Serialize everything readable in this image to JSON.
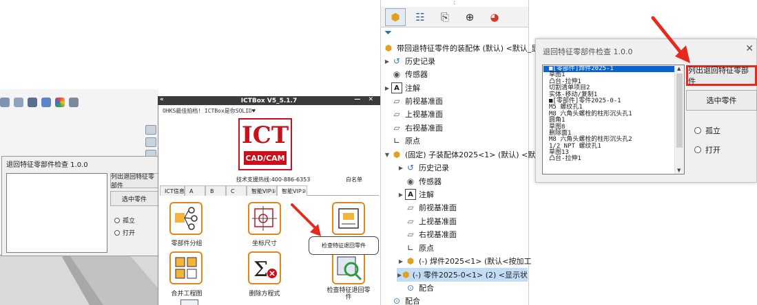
{
  "ictbox": {
    "title": "ICTBox V5_5.1.7",
    "collapse": "«",
    "controls": "— ✕",
    "marquee": "OHKS最佳拍档! ICTBox是你SOLID♥",
    "logo_main": "ICT",
    "logo_sub": "CAD/CAM",
    "hotline": "技术支援热线:400-886-6353",
    "whitelist": "白名单",
    "tabs": [
      "ICT信息",
      "A",
      "B",
      "C",
      "智能VIP①",
      "智能VIP②"
    ],
    "active_tab": 5,
    "tiles": [
      {
        "label": "零部件分组"
      },
      {
        "label": "坐标尺寸"
      },
      {
        "label": ""
      },
      {
        "label": "合并工程图"
      },
      {
        "label": "删除方程式"
      },
      {
        "label": "检查特征退回零件"
      }
    ],
    "tooltip": "检查特征退回零件"
  },
  "small_dialog": {
    "title": "退回特征零部件检查 1.0.0",
    "btn_list": "列出退回特征零部件",
    "btn_select": "选中零件",
    "radio_isolate": "孤立",
    "radio_open": "打开"
  },
  "tree": {
    "root": "带回退特征零件的装配体 (默认) <默认_显",
    "items": [
      {
        "label": "历史记录",
        "icon": "history-icon"
      },
      {
        "label": "传感器",
        "icon": "sensor-icon"
      },
      {
        "label": "注解",
        "icon": "annotation-icon"
      },
      {
        "label": "前视基准面",
        "icon": "plane-icon"
      },
      {
        "label": "上视基准面",
        "icon": "plane-icon"
      },
      {
        "label": "右视基准面",
        "icon": "plane-icon"
      },
      {
        "label": "原点",
        "icon": "origin-icon"
      },
      {
        "label": "(固定) 子装配体2025<1> (默认) <默",
        "icon": "subassembly-icon"
      },
      {
        "label": "历史记录",
        "icon": "history-icon"
      },
      {
        "label": "传感器",
        "icon": "sensor-icon"
      },
      {
        "label": "注解",
        "icon": "annotation-icon"
      },
      {
        "label": "前视基准面",
        "icon": "plane-icon"
      },
      {
        "label": "上视基准面",
        "icon": "plane-icon"
      },
      {
        "label": "右视基准面",
        "icon": "plane-icon"
      },
      {
        "label": "原点",
        "icon": "origin-icon"
      },
      {
        "label": "(-) 焊件2025<1> (默认<按加工",
        "icon": "part-icon"
      },
      {
        "label": "(-) 零件2025-0<1> (2) <显示状",
        "icon": "part-icon"
      },
      {
        "label": "配合",
        "icon": "mate-icon"
      },
      {
        "label": "配合",
        "icon": "mate-icon"
      }
    ]
  },
  "big_dialog": {
    "title": "退回特征零部件检查 1.0.0",
    "close": "✕",
    "list_items": [
      "■[零部件]焊件2025-1",
      "草图1",
      "凸台-拉伸1",
      "切割清单项目2",
      "实体-移动/复制1",
      "■[零部件]零件2025-0-1",
      "M5 螺纹孔1",
      "M8 六角头螺栓的柱形沉头孔1",
      "圆角1",
      "草图8",
      "删除面1",
      "M8 六角头螺栓的柱形沉头孔2",
      "1/2 NPT 螺纹孔1",
      "草图13",
      "凸台-拉伸1"
    ],
    "btn_list": "列出退回特征零部件",
    "btn_select": "选中零件",
    "radio_isolate": "孤立",
    "radio_open": "打开"
  },
  "colors": {
    "accent_red": "#e62b1e",
    "ict_red": "#c9101b",
    "tile_orange": "#e0861e",
    "selection_blue": "#0c63d0"
  }
}
